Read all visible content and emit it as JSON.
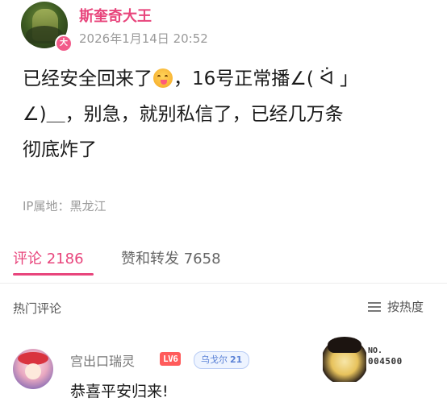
{
  "post": {
    "username": "斯奎奇大王",
    "avatar_badge": "大",
    "timestamp": "2026年1月14日 20:52",
    "content_lines": [
      {
        "before": "已经安全回来了",
        "emoji": "yum-face-emoji",
        "after": "，16号正常播∠( ᐛ 」"
      },
      {
        "text": "∠)＿，别急，就别私信了，已经几万条"
      },
      {
        "text": "彻底炸了"
      }
    ],
    "ip_location": "IP属地：黑龙江"
  },
  "tabs": {
    "comments": "评论 2186",
    "likes_reposts": "赞和转发 7658"
  },
  "comments_section": {
    "hot_label": "热门评论",
    "sort_label": "按热度",
    "sort_icon": "list-icon"
  },
  "comment": {
    "user": "宫出口瑞灵",
    "level": "LV6",
    "medal_name": "乌戈尔",
    "medal_level": "21",
    "text": "恭喜平安归来!",
    "decor_no": "NO.",
    "decor_number": "004500"
  },
  "colors": {
    "accent": "#e8457c",
    "muted": "#9a9a9a",
    "level_badge": "#ff5b5b",
    "medal": "#5b82d6"
  }
}
